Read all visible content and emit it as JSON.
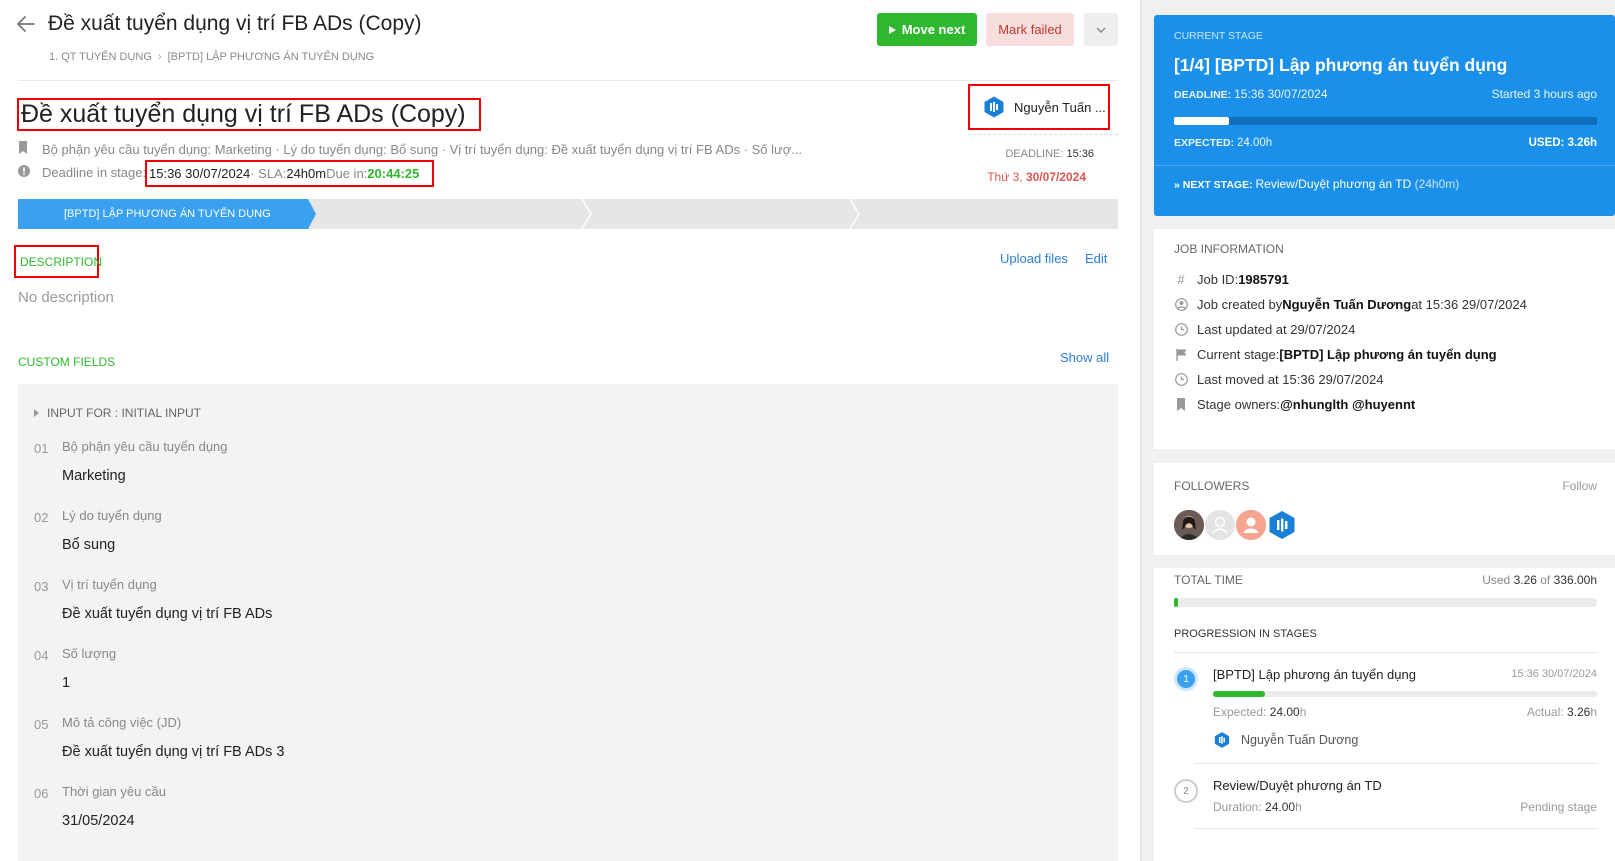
{
  "header": {
    "title": "Đề xuất tuyển dụng vị trí FB ADs (Copy)",
    "breadcrumb": [
      "1. QT TUYỂN DỤNG",
      "[BPTD] LẬP PHƯƠNG ÁN TUYỂN DỤNG"
    ],
    "move_next_label": "Move next",
    "mark_failed_label": "Mark failed"
  },
  "job": {
    "title": "Đề xuất tuyển dụng vị trí FB ADs (Copy)",
    "assignee": "Nguyễn Tuấn ...",
    "summary": "Bộ phận yêu cầu tuyển dụng: Marketing · Lý do tuyển dụng: Bổ sung · Vị trí tuyển dụng: Đề xuất tuyển dụng vị trí FB ADs · Số lượ...",
    "deadline_label": "Deadline in stage:",
    "deadline_value": "15:36 30/07/2024",
    "sla_label": " · SLA: ",
    "sla_value": "24h0m",
    "due_label": " Due in: ",
    "due_value": "20:44:25",
    "deadline_right_label": "DEADLINE: ",
    "deadline_right_time": "15:36",
    "deadline_right_day": "Thứ 3, ",
    "deadline_right_date": "30/07/2024",
    "active_stage": "[BPTD] LẬP PHƯƠNG ÁN TUYỂN DỤNG"
  },
  "description": {
    "heading": "DESCRIPTION",
    "upload_label": "Upload files",
    "edit_label": "Edit",
    "empty_text": "No description"
  },
  "custom_fields": {
    "heading": "CUSTOM FIELDS",
    "show_all_label": "Show all",
    "group_label": "INPUT FOR : INITIAL INPUT",
    "items": [
      {
        "num": "01",
        "label": "Bộ phận yêu cầu tuyển dụng",
        "value": "Marketing"
      },
      {
        "num": "02",
        "label": "Lý do tuyển dụng",
        "value": "Bổ sung"
      },
      {
        "num": "03",
        "label": "Vị trí tuyển dụng",
        "value": "Đề xuất tuyển dụng vị trí FB ADs"
      },
      {
        "num": "04",
        "label": "Số lượng",
        "value": "1"
      },
      {
        "num": "05",
        "label": "Mô tả công việc (JD)",
        "value": "Đề xuất tuyển dụng vị trí FB ADs 3"
      },
      {
        "num": "06",
        "label": "Thời gian yêu cầu",
        "value": "31/05/2024"
      }
    ]
  },
  "current_stage": {
    "label": "CURRENT STAGE",
    "title": "[1/4] [BPTD] Lập phương án tuyển dụng",
    "deadline_key": "DEADLINE: ",
    "deadline_value": "15:36 30/07/2024",
    "started": "Started 3 hours ago",
    "progress_fraction": 0.13,
    "expected_key": "EXPECTED: ",
    "expected_value": "24.00h",
    "used_key": "USED: ",
    "used_value": "3.26h",
    "next_key": "» NEXT STAGE: ",
    "next_value": "Review/Duyệt phương án TD",
    "next_duration": " (24h0m)"
  },
  "job_info": {
    "heading": "JOB INFORMATION",
    "job_id_label": "Job ID: ",
    "job_id": "1985791",
    "created_prefix": "Job created by ",
    "created_by": "Nguyễn Tuấn Dương",
    "created_at": " at 15:36 29/07/2024",
    "last_updated": "Last updated at 29/07/2024",
    "current_stage_label": "Current stage: ",
    "current_stage_value": "[BPTD] Lập phương án tuyển dụng",
    "last_moved": "Last moved at 15:36 29/07/2024",
    "owners_label": "Stage owners: ",
    "owners_value": "@nhunglth @huyennt"
  },
  "followers": {
    "heading": "FOLLOWERS",
    "follow_label": "Follow"
  },
  "total_time": {
    "heading": "TOTAL TIME",
    "used_label": "Used ",
    "used_value": "3.26",
    "of_label": " of ",
    "total_value": "336.00h",
    "progress_fraction": 0.0097,
    "progression_heading": "PROGRESSION IN STAGES",
    "stages": [
      {
        "num": "1",
        "name": "[BPTD] Lập phương án tuyển dụng",
        "time": "15:36 30/07/2024",
        "progress_fraction": 0.136,
        "expected_label": "Expected: ",
        "expected_value": "24.00",
        "actual_label": "Actual: ",
        "actual_value": "3.26",
        "user": "Nguyễn Tuấn Dương"
      },
      {
        "num": "2",
        "name": "Review/Duyệt phương án TD",
        "duration_label": "Duration: ",
        "duration_value": "24.00",
        "status": "Pending stage"
      }
    ]
  },
  "colors": {
    "accent_blue": "#1a90ea",
    "green": "#2eb82e",
    "danger": "#e0524f",
    "highlight_box": "#e00000"
  }
}
